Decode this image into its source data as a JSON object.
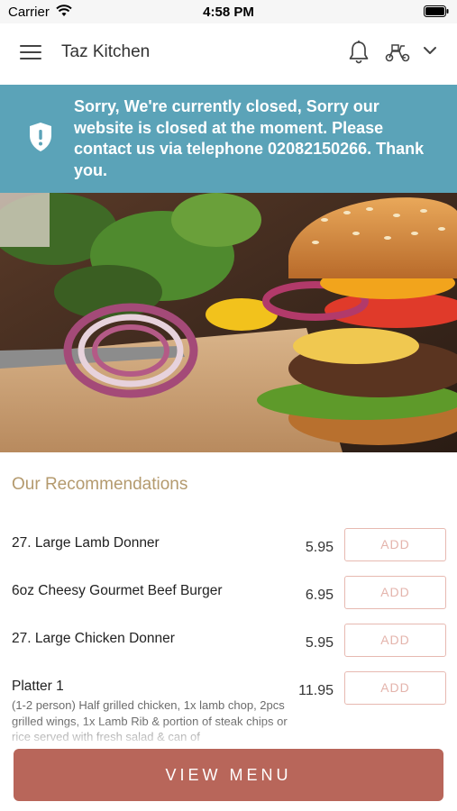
{
  "status_bar": {
    "carrier": "Carrier",
    "time": "4:58 PM"
  },
  "header": {
    "title": "Taz Kitchen",
    "icons": [
      "menu-icon",
      "bell-icon",
      "delivery-scooter-icon",
      "chevron-down-icon"
    ]
  },
  "banner": {
    "message": "Sorry, We're currently closed, Sorry our website is closed at the moment. Please contact us via telephone 02082150266. Thank you.",
    "color": "#5ba3b8",
    "icon": "shield-icon"
  },
  "recommendations": {
    "title": "Our Recommendations",
    "items": [
      {
        "name": "27. Large Lamb Donner",
        "price": "5.95",
        "button": "ADD"
      },
      {
        "name": "6oz Cheesy Gourmet Beef Burger",
        "price": "6.95",
        "button": "ADD"
      },
      {
        "name": "27. Large Chicken Donner",
        "price": "5.95",
        "button": "ADD"
      },
      {
        "name": "Platter 1",
        "price": "11.95",
        "button": "ADD",
        "description": "(1-2 person) Half grilled chicken, 1x lamb chop, 2pcs grilled wings, 1x Lamb Rib & portion of steak chips or rice served with fresh salad & can of"
      }
    ]
  },
  "footer": {
    "button_label": "VIEW MENU",
    "button_color": "#b8665a"
  }
}
